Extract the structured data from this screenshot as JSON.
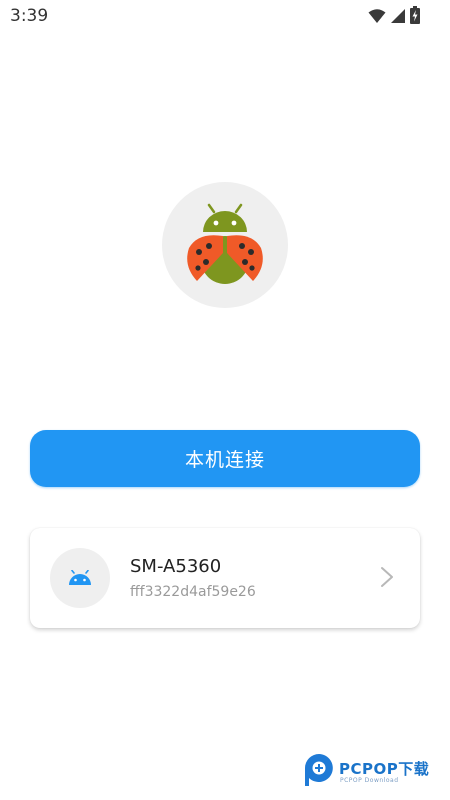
{
  "status_bar": {
    "time": "3:39",
    "icons": [
      "wifi-icon",
      "signal-icon",
      "battery-charging-icon"
    ]
  },
  "app_logo": {
    "icon": "ladybug-android-icon",
    "colors": {
      "android_green": "#7e961f",
      "ladybug_orange": "#f05a28",
      "spots": "#2b2b2b"
    }
  },
  "connect_button": {
    "label": "本机连接",
    "color": "#2196f3"
  },
  "devices": [
    {
      "name": "SM-A5360",
      "id": "fff3322d4af59e26",
      "icon": "android-icon",
      "icon_color": "#2196f3"
    }
  ],
  "watermark": {
    "brand": "PCPOP下载",
    "sub": "PCPOP Download"
  }
}
